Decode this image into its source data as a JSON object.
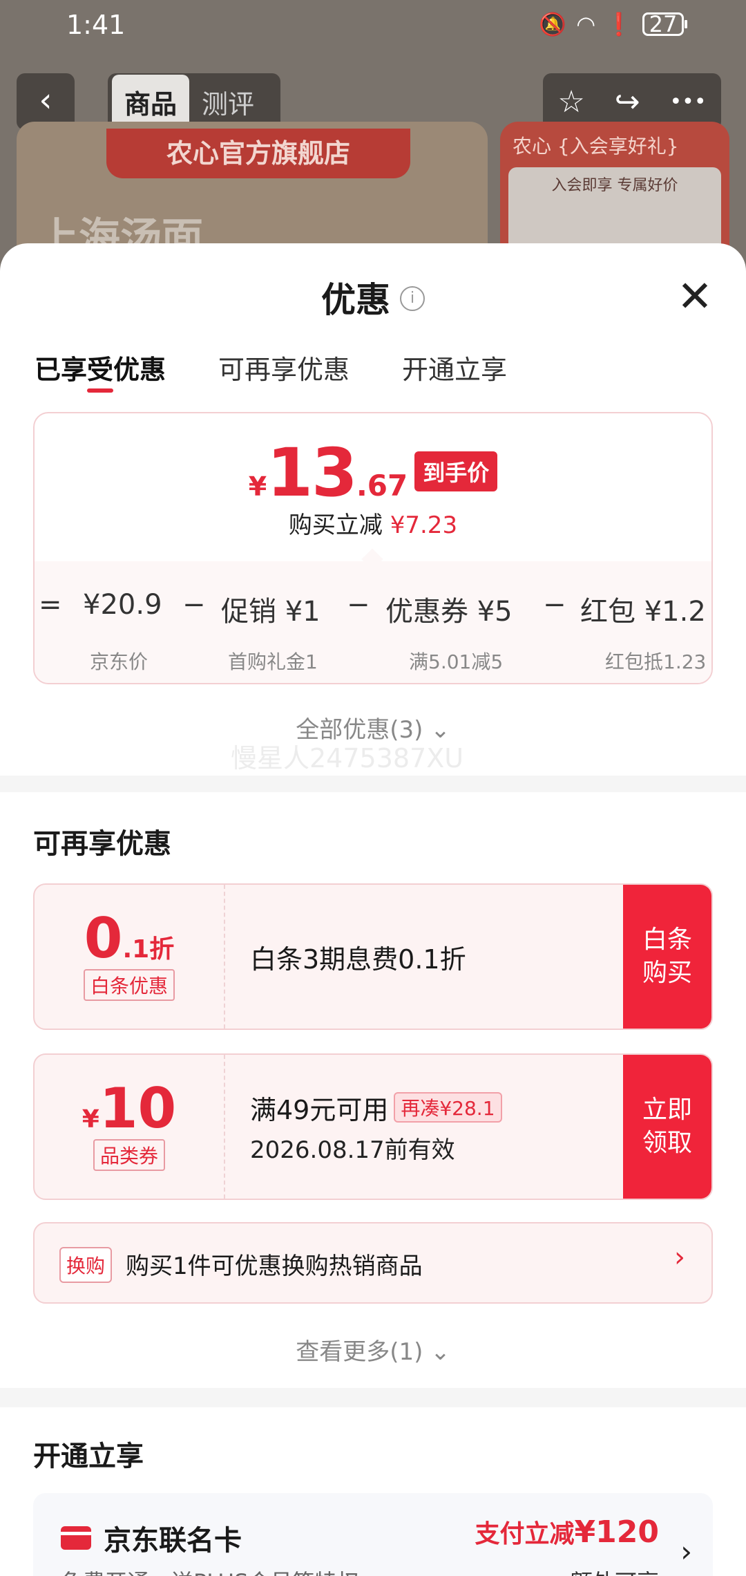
{
  "status_bar": {
    "time": "1:41",
    "battery": "27"
  },
  "top_nav": {
    "back": "‹",
    "tabs": [
      "商品",
      "测评"
    ],
    "star": "☆",
    "share": "↪",
    "more": "•••"
  },
  "banner": {
    "store_name": "农心官方旗舰店",
    "banner_text": "上海汤面",
    "right_title": "农心  {入会享好礼}",
    "right_inner_title": "入会即享 专属好价"
  },
  "sheet": {
    "title": "优惠",
    "info": "i",
    "close": "✕",
    "tabs": [
      "已享受优惠",
      "可再享优惠",
      "开通立享"
    ],
    "price": {
      "currency": "¥",
      "integer": "13",
      "decimal": ".67",
      "tag": "到手价",
      "save_label": "购买立减",
      "save_value": "¥7.23"
    },
    "breakdown": [
      {
        "op": "=",
        "label": "¥20.9",
        "sub": "京东价"
      },
      {
        "op": "−",
        "label": "促销 ¥1",
        "sub": "首购礼金1"
      },
      {
        "op": "−",
        "label": "优惠券 ¥5",
        "sub": "满5.01减5"
      },
      {
        "op": "−",
        "label": "红包 ¥1.2",
        "sub": "红包抵1.23"
      }
    ],
    "all_offers": "全部优惠(3) ⌄",
    "watermark": "慢星人2475387XU",
    "more_section": {
      "title": "可再享优惠",
      "coupons": [
        {
          "value_big": "0",
          "value_small": ".1折",
          "tag": "白条优惠",
          "main": "白条3期息费0.1折",
          "button": "白条购买"
        },
        {
          "prefix": "¥",
          "value_big": "10",
          "tag": "品类券",
          "main": "满49元可用",
          "badge": "再凑¥28.1",
          "sub": "2026.08.17前有效",
          "button": "立即领取"
        }
      ],
      "swap": {
        "tag": "换购",
        "text": "购买1件可优惠换购热销商品",
        "chev": "›"
      },
      "see_more": "查看更多(1) ⌄"
    },
    "open_section": {
      "title": "开通立享",
      "card": {
        "name": "京东联名卡",
        "promo_label": "支付立减",
        "promo_value": "¥120",
        "sub": "免费开通，送PLUS会员等特权",
        "extra": "额外可享",
        "chev": "›"
      }
    }
  },
  "colors": {
    "accent": "#e4283a",
    "button": "#f0243a",
    "coupon_bg": "#fdf3f3"
  }
}
